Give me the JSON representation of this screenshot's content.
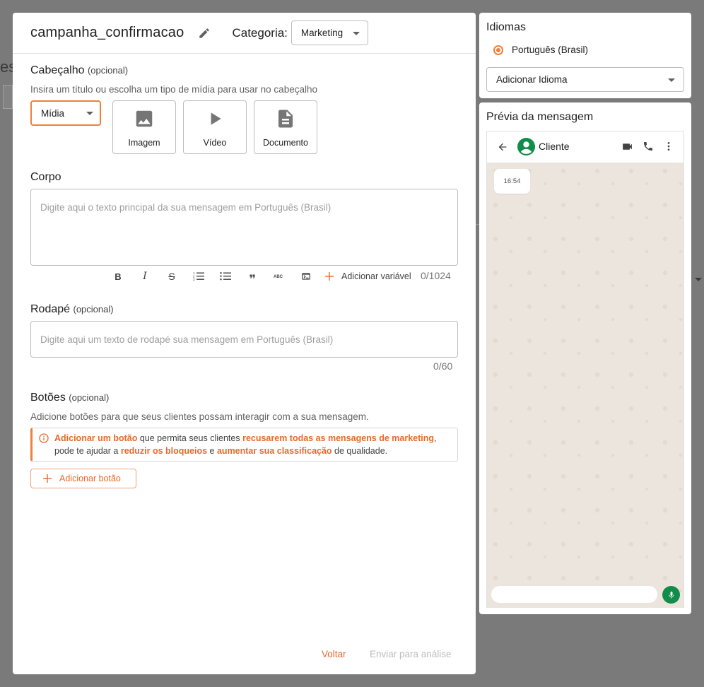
{
  "background": {
    "fragment_text": "es"
  },
  "template": {
    "name": "campanha_confirmacao",
    "category_label": "Categoria:",
    "category_value": "Marketing"
  },
  "header_section": {
    "title": "Cabeçalho",
    "optional": "(opcional)",
    "hint": "Insira um título ou escolha um tipo de mídia para usar no cabeçalho",
    "type_value": "Mídia",
    "media_options": [
      {
        "label": "Imagem",
        "icon": "image-icon"
      },
      {
        "label": "Vídeo",
        "icon": "play-icon"
      },
      {
        "label": "Documento",
        "icon": "document-icon"
      }
    ]
  },
  "body_section": {
    "title": "Corpo",
    "placeholder": "Digite aqui o texto principal da sua mensagem em Português (Brasil)",
    "add_variable": "Adicionar variável",
    "counter": "0/1024"
  },
  "footer_section": {
    "title": "Rodapé",
    "optional": "(opcional)",
    "placeholder": "Digite aqui um texto de rodapé sua mensagem em Português (Brasil)",
    "counter": "0/60"
  },
  "buttons_section": {
    "title": "Botões",
    "optional": "(opcional)",
    "hint": "Adicione botões para que seus clientes possam interagir com a sua mensagem.",
    "alert": {
      "part1": "Adicionar um botão",
      "part2": " que permita seus clientes ",
      "part3": "recusarem todas as mensagens de marketing",
      "part4": ",",
      "part5": "pode te ajudar a ",
      "part6": "reduzir os bloqueios",
      "part7": " e ",
      "part8": "aumentar sua classificação",
      "part9": " de qualidade."
    },
    "add_button": "Adicionar botão"
  },
  "actions": {
    "back": "Voltar",
    "submit": "Enviar para análise"
  },
  "languages": {
    "title": "Idiomas",
    "selected": "Português (Brasil)",
    "add_placeholder": "Adicionar Idioma"
  },
  "preview": {
    "title": "Prévia da mensagem",
    "contact": "Cliente",
    "time": "16:54"
  },
  "colors": {
    "accent": "#f07f3c",
    "accent_text": "#e8692a",
    "whatsapp_green": "#128c4b",
    "chat_bg": "#ece5dd"
  }
}
